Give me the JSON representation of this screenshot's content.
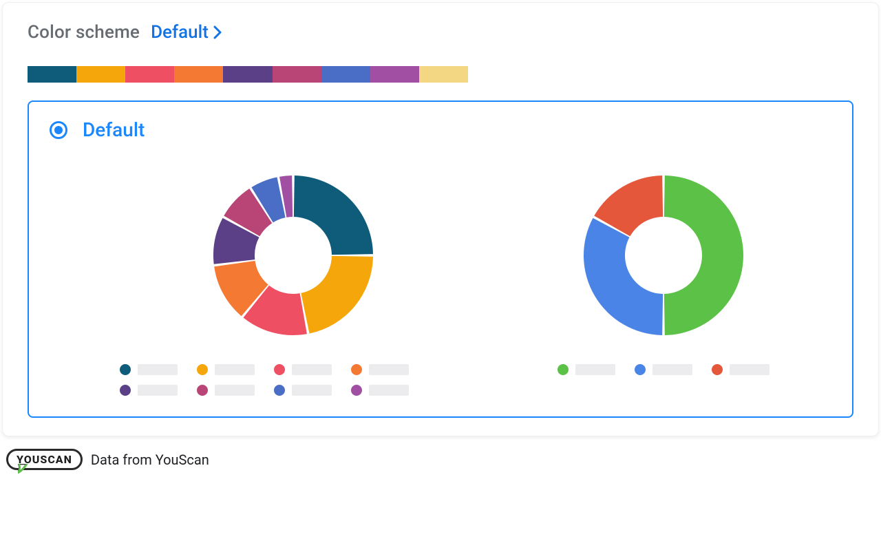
{
  "header": {
    "label": "Color scheme",
    "scheme_name": "Default"
  },
  "palette": [
    "#0f5c7a",
    "#f5a60a",
    "#ef4f62",
    "#f47a33",
    "#5b3f87",
    "#b94576",
    "#4a6ec5",
    "#a04fa3",
    "#f4d782"
  ],
  "option": {
    "title": "Default",
    "selected": true
  },
  "chart_data": [
    {
      "type": "pie",
      "title": "",
      "inner_radius": 56,
      "outer_radius": 116,
      "series": [
        {
          "name": "",
          "value": 25,
          "color": "#0f5c7a"
        },
        {
          "name": "",
          "value": 22,
          "color": "#f5a60a"
        },
        {
          "name": "",
          "value": 14,
          "color": "#ef4f62"
        },
        {
          "name": "",
          "value": 12,
          "color": "#f47a33"
        },
        {
          "name": "",
          "value": 10,
          "color": "#5b3f87"
        },
        {
          "name": "",
          "value": 8,
          "color": "#b94576"
        },
        {
          "name": "",
          "value": 6,
          "color": "#4a6ec5"
        },
        {
          "name": "",
          "value": 3,
          "color": "#a04fa3"
        }
      ],
      "legend_colors": [
        "#0f5c7a",
        "#f5a60a",
        "#ef4f62",
        "#f47a33",
        "#5b3f87",
        "#b94576",
        "#4a6ec5",
        "#a04fa3"
      ]
    },
    {
      "type": "pie",
      "title": "",
      "inner_radius": 56,
      "outer_radius": 116,
      "series": [
        {
          "name": "",
          "value": 50,
          "color": "#5cc247"
        },
        {
          "name": "",
          "value": 33,
          "color": "#4a84e6"
        },
        {
          "name": "",
          "value": 17,
          "color": "#e5573b"
        }
      ],
      "legend_colors": [
        "#5cc247",
        "#4a84e6",
        "#e5573b"
      ]
    }
  ],
  "footer": {
    "brand": "YOUSCAN",
    "text": "Data from YouScan"
  }
}
